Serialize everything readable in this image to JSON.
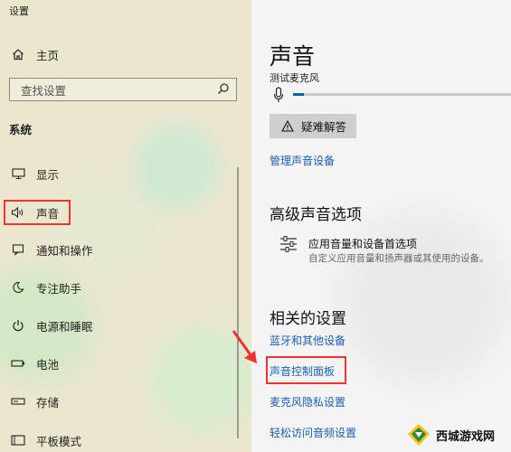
{
  "app_title": "设置",
  "sidebar": {
    "home": {
      "label": "主页",
      "icon": "home-icon"
    },
    "search": {
      "placeholder": "查找设置",
      "icon": "search-icon"
    },
    "section": "系统",
    "items": [
      {
        "label": "显示",
        "icon": "display-icon"
      },
      {
        "label": "声音",
        "icon": "speaker-icon",
        "selected": true
      },
      {
        "label": "通知和操作",
        "icon": "notification-icon"
      },
      {
        "label": "专注助手",
        "icon": "moon-icon"
      },
      {
        "label": "电源和睡眠",
        "icon": "power-icon"
      },
      {
        "label": "电池",
        "icon": "battery-icon"
      },
      {
        "label": "存储",
        "icon": "storage-icon"
      },
      {
        "label": "平板模式",
        "icon": "tablet-icon"
      }
    ]
  },
  "main": {
    "title": "声音",
    "mic_test_label": "测试麦克风",
    "mic_level": 0.05,
    "troubleshoot_label": "疑难解答",
    "manage_devices_link": "管理声音设备",
    "advanced": {
      "heading": "高级声音选项",
      "item_title": "应用音量和设备首选项",
      "item_desc": "自定义应用音量和扬声器或其使用的设备。"
    },
    "related": {
      "heading": "相关的设置",
      "links": [
        "蓝牙和其他设备",
        "声音控制面板",
        "麦克风隐私设置",
        "轻松访问音频设置"
      ]
    }
  },
  "watermark": {
    "text": "西城游戏网"
  },
  "colors": {
    "accent": "#0a63b0",
    "highlight": "#e33333",
    "link": "#1a5fb0"
  }
}
